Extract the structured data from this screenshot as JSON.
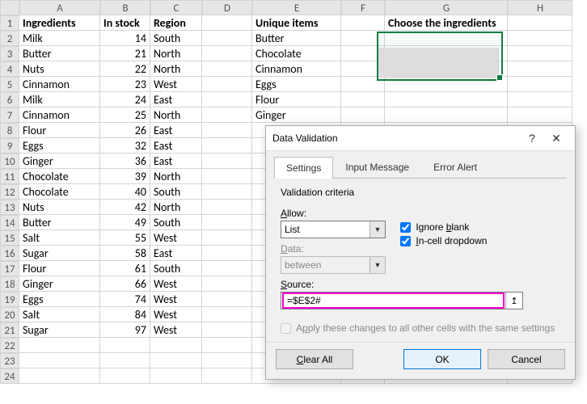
{
  "columns": [
    "A",
    "B",
    "C",
    "D",
    "E",
    "F",
    "G",
    "H"
  ],
  "rows": [
    "1",
    "2",
    "3",
    "4",
    "5",
    "6",
    "7",
    "8",
    "9",
    "10",
    "11",
    "12",
    "13",
    "14",
    "15",
    "16",
    "17",
    "18",
    "19",
    "20",
    "21",
    "22",
    "23",
    "24"
  ],
  "headers": {
    "A1": "Ingredients",
    "B1": "In stock",
    "C1": "Region",
    "E1": "Unique items",
    "G1": "Choose the ingredients"
  },
  "tableA": [
    {
      "ing": "Milk",
      "stk": 14,
      "reg": "South"
    },
    {
      "ing": "Butter",
      "stk": 21,
      "reg": "North"
    },
    {
      "ing": "Nuts",
      "stk": 22,
      "reg": "North"
    },
    {
      "ing": "Cinnamon",
      "stk": 23,
      "reg": "West"
    },
    {
      "ing": "Milk",
      "stk": 24,
      "reg": "East"
    },
    {
      "ing": "Cinnamon",
      "stk": 25,
      "reg": "North"
    },
    {
      "ing": "Flour",
      "stk": 26,
      "reg": "East"
    },
    {
      "ing": "Eggs",
      "stk": 32,
      "reg": "East"
    },
    {
      "ing": "Ginger",
      "stk": 36,
      "reg": "East"
    },
    {
      "ing": "Chocolate",
      "stk": 39,
      "reg": "North"
    },
    {
      "ing": "Chocolate",
      "stk": 40,
      "reg": "South"
    },
    {
      "ing": "Nuts",
      "stk": 42,
      "reg": "North"
    },
    {
      "ing": "Butter",
      "stk": 49,
      "reg": "South"
    },
    {
      "ing": "Salt",
      "stk": 55,
      "reg": "West"
    },
    {
      "ing": "Sugar",
      "stk": 58,
      "reg": "East"
    },
    {
      "ing": "Flour",
      "stk": 61,
      "reg": "South"
    },
    {
      "ing": "Ginger",
      "stk": 66,
      "reg": "West"
    },
    {
      "ing": "Eggs",
      "stk": 74,
      "reg": "West"
    },
    {
      "ing": "Salt",
      "stk": 84,
      "reg": "West"
    },
    {
      "ing": "Sugar",
      "stk": 97,
      "reg": "West"
    }
  ],
  "unique": [
    "Butter",
    "Chocolate",
    "Cinnamon",
    "Eggs",
    "Flour",
    "Ginger"
  ],
  "dialog": {
    "title": "Data Validation",
    "tabs": {
      "settings": "Settings",
      "input_msg": "Input Message",
      "error": "Error Alert"
    },
    "criteria": "Validation criteria",
    "allow_label": "Allow:",
    "allow_value": "List",
    "data_label": "Data:",
    "data_value": "between",
    "source_label": "Source:",
    "source_value": "=$E$2#",
    "ignore_blank": "Ignore blank",
    "incell": "In-cell dropdown",
    "apply": "Apply these changes to all other cells with the same settings",
    "clear": "Clear All",
    "ok": "OK",
    "cancel": "Cancel",
    "help": "?",
    "close": "✕",
    "range_arrow": "↥"
  }
}
